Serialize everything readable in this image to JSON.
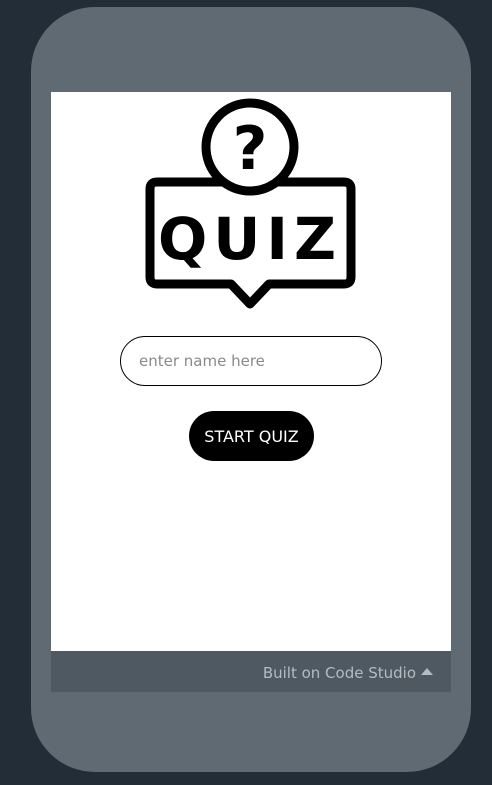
{
  "app": {
    "logo_text": "QUIZ",
    "logo_symbol": "?"
  },
  "name_field": {
    "value": "",
    "placeholder": "enter name here"
  },
  "start_button": {
    "label": "START QUIZ"
  },
  "footer": {
    "built_on_label": "Built on Code Studio",
    "icon": "caret-up-icon"
  },
  "colors": {
    "background": "#222d37",
    "phone_frame": "#5f6a72",
    "screen": "#ffffff",
    "footer_bar": "#4f5961",
    "button": "#000000",
    "footer_text": "#b4bcc2"
  }
}
